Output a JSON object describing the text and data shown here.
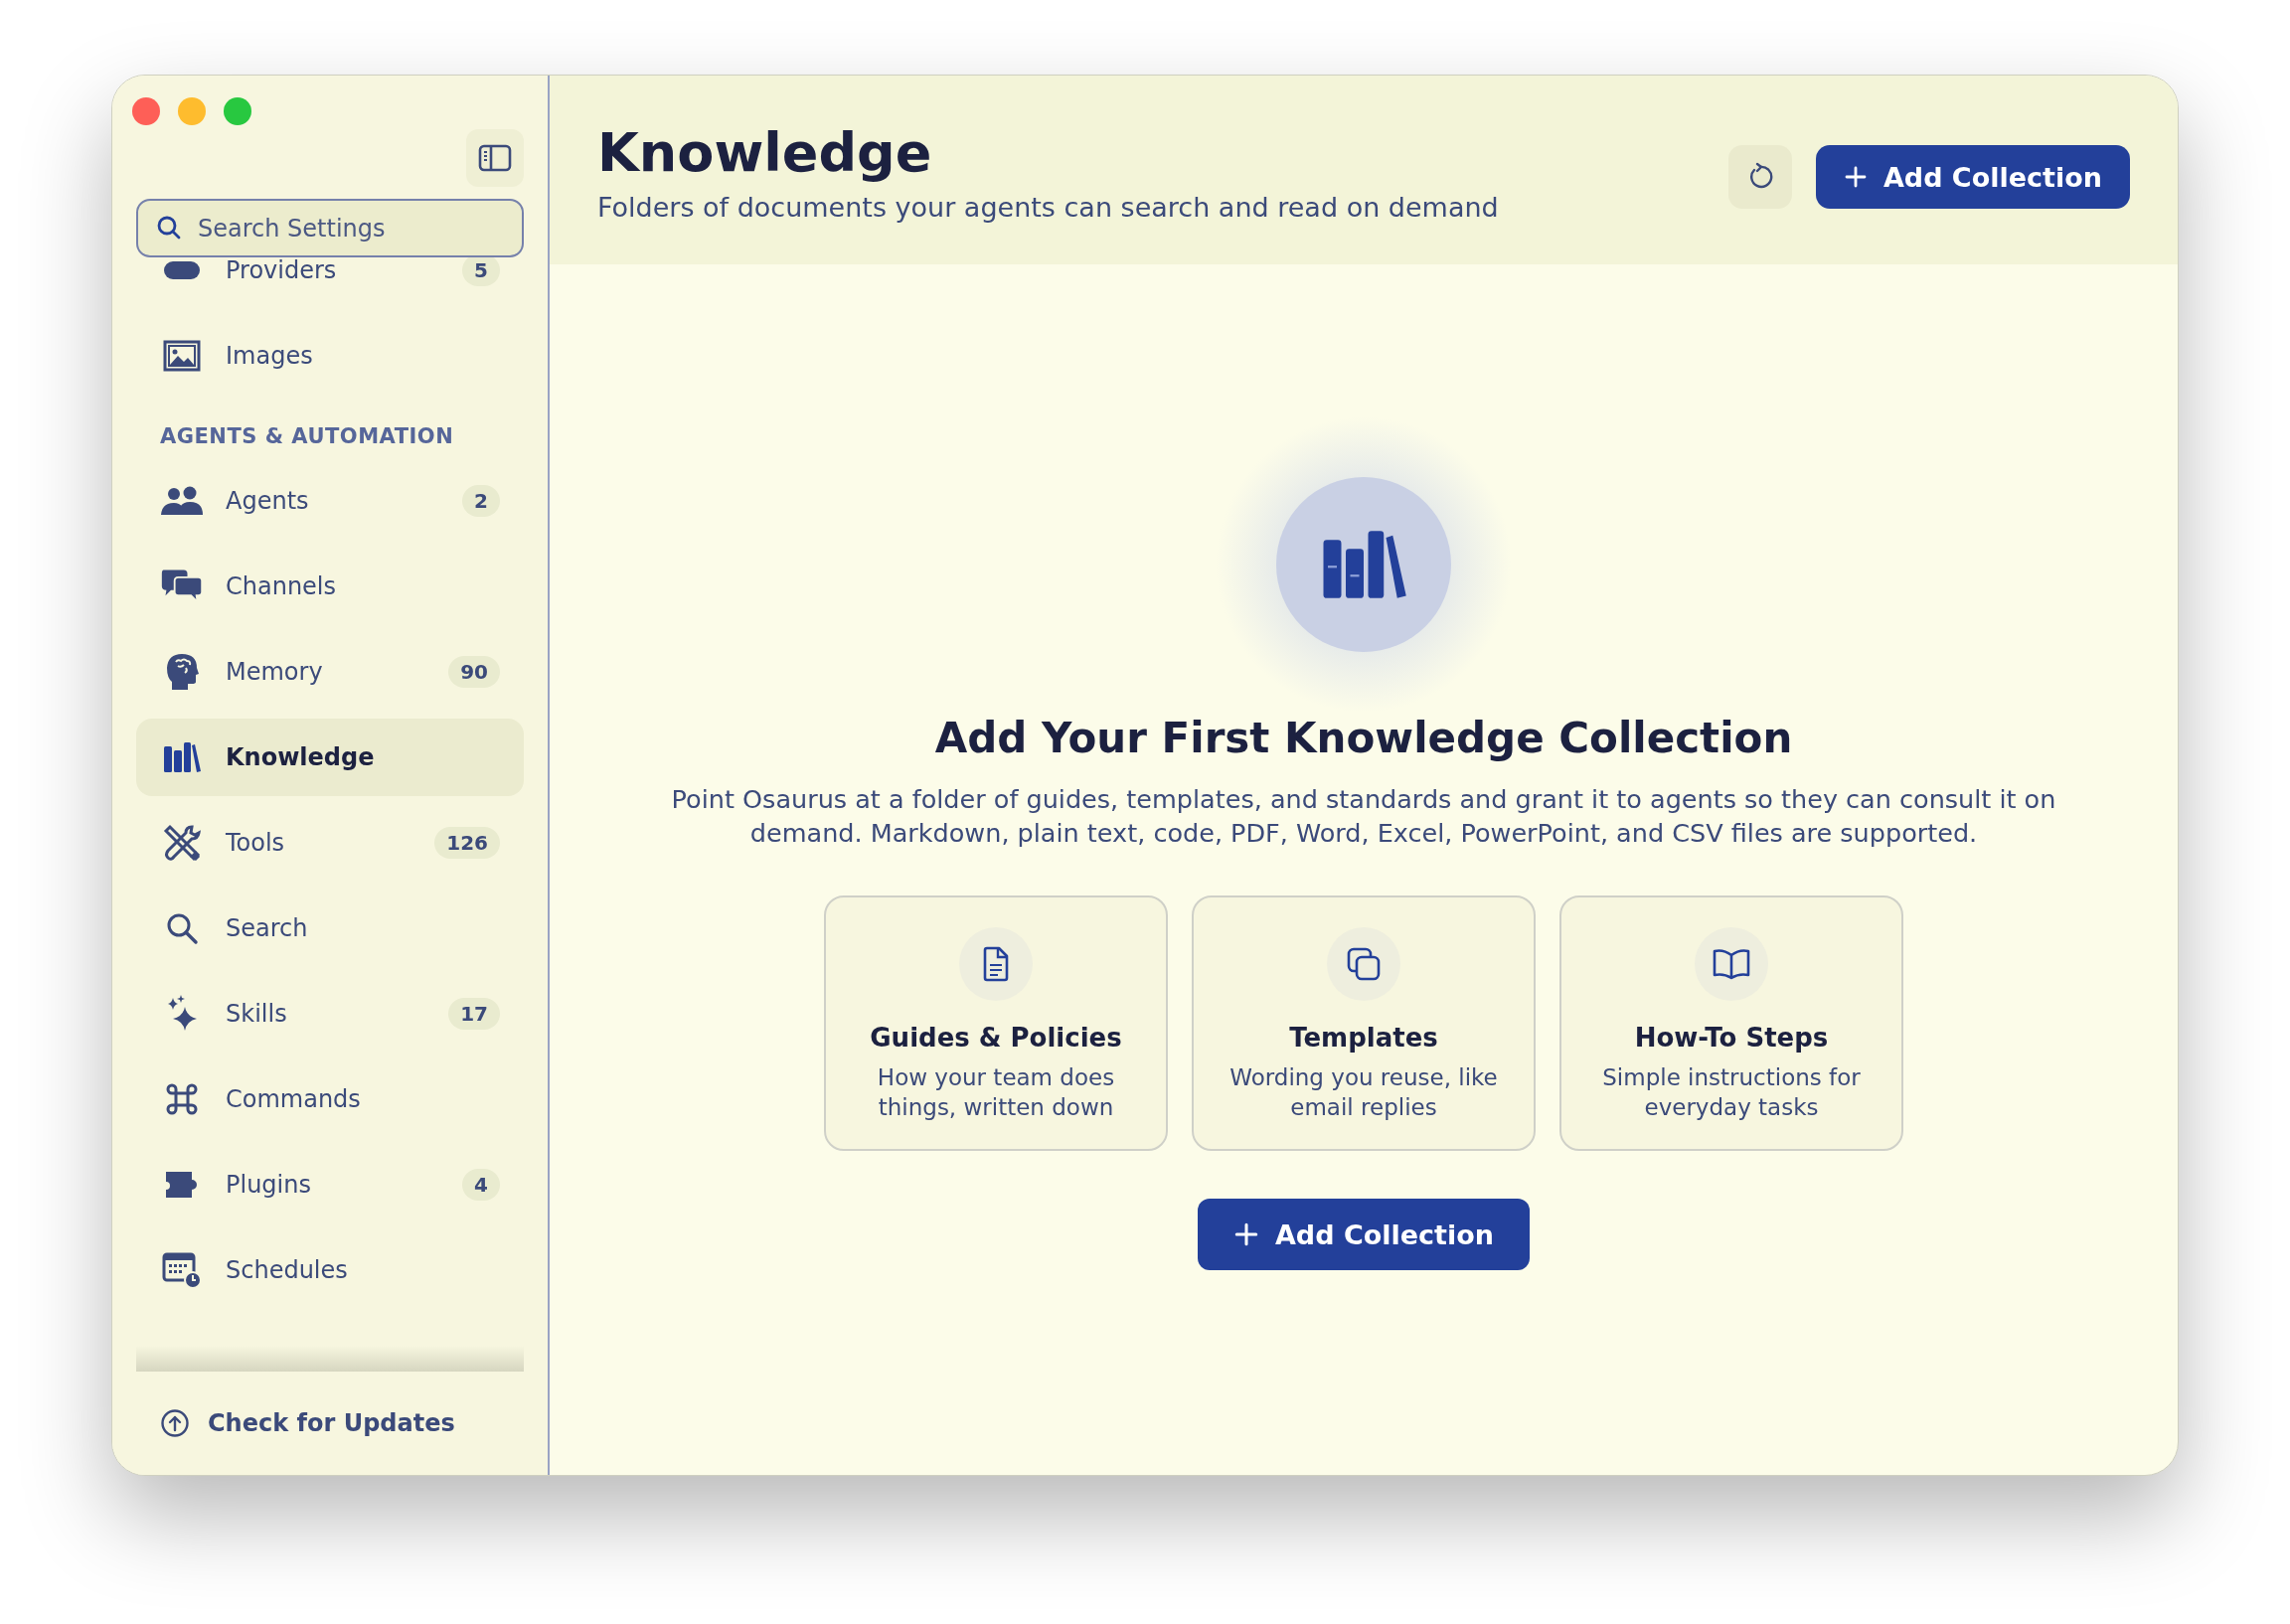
{
  "sidebar": {
    "search": {
      "placeholder": "Search Settings"
    },
    "items": [
      {
        "kind": "item",
        "label": "Providers",
        "badge": "5",
        "selected": false
      },
      {
        "kind": "item",
        "label": "Images",
        "selected": false
      },
      {
        "kind": "section",
        "label": "AGENTS & AUTOMATION"
      },
      {
        "kind": "item",
        "label": "Agents",
        "badge": "2",
        "selected": false
      },
      {
        "kind": "item",
        "label": "Channels",
        "selected": false
      },
      {
        "kind": "item",
        "label": "Memory",
        "badge": "90",
        "selected": false
      },
      {
        "kind": "item",
        "label": "Knowledge",
        "selected": true
      },
      {
        "kind": "item",
        "label": "Tools",
        "badge": "126",
        "selected": false
      },
      {
        "kind": "item",
        "label": "Search",
        "selected": false
      },
      {
        "kind": "item",
        "label": "Skills",
        "badge": "17",
        "selected": false
      },
      {
        "kind": "item",
        "label": "Commands",
        "selected": false
      },
      {
        "kind": "item",
        "label": "Plugins",
        "badge": "4",
        "selected": false
      },
      {
        "kind": "item",
        "label": "Schedules",
        "selected": false
      }
    ],
    "footer_link": "Check for Updates"
  },
  "header": {
    "title": "Knowledge",
    "subtitle": "Folders of documents your agents can search and read on demand",
    "add_button": "Add Collection"
  },
  "empty_state": {
    "title": "Add Your First Knowledge Collection",
    "description": "Point Osaurus at a folder of guides, templates, and standards and grant it to agents so they can consult it on demand. Markdown, plain text, code, PDF, Word, Excel, PowerPoint, and CSV files are supported.",
    "cards": [
      {
        "title": "Guides & Policies",
        "text": "How your team does things, written down"
      },
      {
        "title": "Templates",
        "text": "Wording you reuse, like email replies"
      },
      {
        "title": "How-To Steps",
        "text": "Simple instructions for everyday tasks"
      }
    ],
    "button": "Add Collection"
  }
}
